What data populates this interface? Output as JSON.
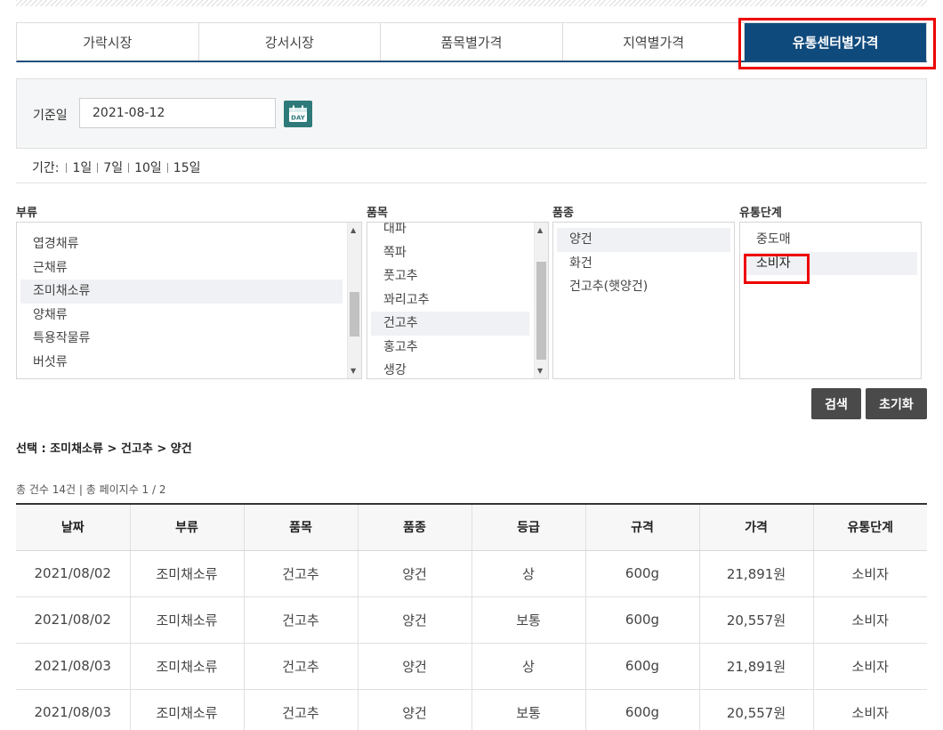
{
  "tabs": [
    {
      "label": "가락시장"
    },
    {
      "label": "강서시장"
    },
    {
      "label": "품목별가격"
    },
    {
      "label": "지역별가격"
    },
    {
      "label": "유통센터별가격"
    }
  ],
  "date": {
    "label": "기준일",
    "value": "2021-08-12",
    "calendar_icon_text": "DAY"
  },
  "period": {
    "label": "기간:",
    "options": [
      "1일",
      "7일",
      "10일",
      "15일"
    ]
  },
  "columns": {
    "category": "부류",
    "item": "품목",
    "variety": "품종",
    "stage": "유통단계"
  },
  "category_list": [
    "엽경채류",
    "근채류",
    "조미채소류",
    "양채류",
    "특용작물류",
    "버섯류"
  ],
  "item_list": [
    "대파",
    "쪽파",
    "풋고추",
    "꽈리고추",
    "건고추",
    "홍고추",
    "생강"
  ],
  "variety_list": [
    "양건",
    "화건",
    "건고추(햇양건)"
  ],
  "stage_list": [
    "중도매",
    "소비자"
  ],
  "buttons": {
    "search": "검색",
    "reset": "초기화"
  },
  "selection_text": "선택 : 조미채소류 > 건고추 > 양건",
  "count_text": "총 건수 14건 | 총 페이지수 1 / 2",
  "table": {
    "headers": [
      "날짜",
      "부류",
      "품목",
      "품종",
      "등급",
      "규격",
      "가격",
      "유통단계"
    ],
    "rows": [
      [
        "2021/08/02",
        "조미채소류",
        "건고추",
        "양건",
        "상",
        "600g",
        "21,891원",
        "소비자"
      ],
      [
        "2021/08/02",
        "조미채소류",
        "건고추",
        "양건",
        "보통",
        "600g",
        "20,557원",
        "소비자"
      ],
      [
        "2021/08/03",
        "조미채소류",
        "건고추",
        "양건",
        "상",
        "600g",
        "21,891원",
        "소비자"
      ],
      [
        "2021/08/03",
        "조미채소류",
        "건고추",
        "양건",
        "보통",
        "600g",
        "20,557원",
        "소비자"
      ]
    ]
  },
  "colors": {
    "active_tab": "#0f4a7c",
    "highlight": "#e00000",
    "button": "#4a4a4a",
    "calendar": "#2e7a7a"
  }
}
